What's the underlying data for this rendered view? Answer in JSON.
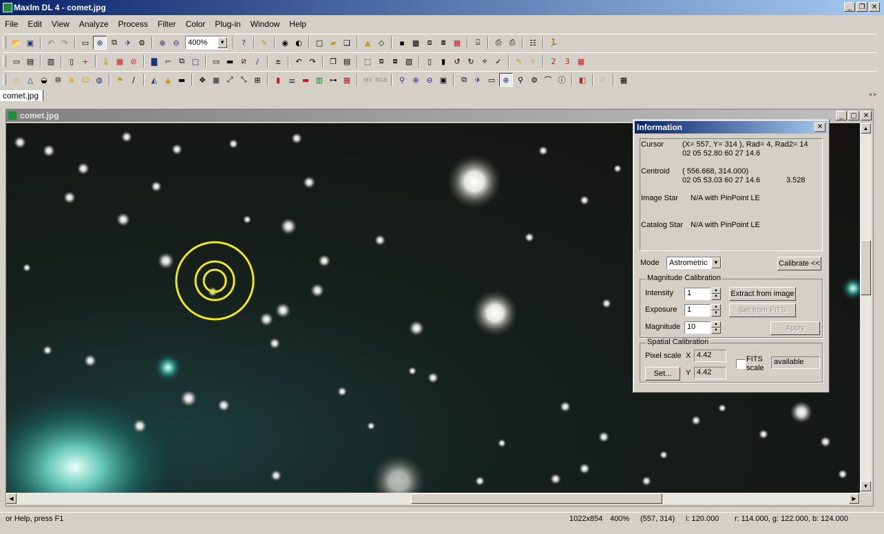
{
  "window": {
    "title": "MaxIm DL 4 - comet.jpg"
  },
  "menu": [
    "File",
    "Edit",
    "View",
    "Analyze",
    "Process",
    "Filter",
    "Color",
    "Plug-in",
    "Window",
    "Help"
  ],
  "toolbar": {
    "zoom_value": "400%"
  },
  "doc_tab": {
    "label": "comet.jpg"
  },
  "child_window": {
    "title": "comet.jpg"
  },
  "info": {
    "title": "Information",
    "cursor_label": "Cursor",
    "cursor_line1": "(X=  557, Y=  314 ), Rad=  4, Rad2= 14",
    "cursor_line2": "02 05 52.80     60 27 14.6",
    "centroid_label": "Centroid",
    "centroid_line1": "( 556.668, 314.000)",
    "centroid_line2": "02 05 53.03     60 27 14.6",
    "centroid_value": "3.528",
    "image_star_label": "Image Star",
    "image_star_value": "N/A with PinPoint LE",
    "catalog_star_label": "Catalog Star",
    "catalog_star_value": "N/A with PinPoint LE",
    "mode_label": "Mode",
    "mode_value": "Astrometric",
    "calibrate_button": "Calibrate <<",
    "mag_group": "Magnitude Calibration",
    "intensity_label": "Intensity",
    "intensity_value": "1",
    "exposure_label": "Exposure",
    "exposure_value": "1",
    "magnitude_label": "Magnitude",
    "magnitude_value": "10",
    "extract_button": "Extract from image",
    "set_fits_button": "Set from FITS",
    "apply_button": "Apply",
    "spatial_group": "Spatial Calibration",
    "pixel_scale_label": "Pixel scale",
    "x_label": "X",
    "x_value": "4.42",
    "y_label": "Y",
    "y_value": "4.42",
    "set_button": "Set...",
    "fits_label_line1": "FITS",
    "fits_label_line2": "scale",
    "fits_value": "available"
  },
  "status": {
    "help": "or Help, press F1",
    "size": "1022x854",
    "zoom": "400%",
    "coords": "(557, 314)",
    "intensity": "i:  120.000",
    "rgb": "r:  114.000, g:  122.000, b:  124.000"
  },
  "colors": {
    "aperture": "#f2ea14",
    "title_active": "#0a246a"
  }
}
